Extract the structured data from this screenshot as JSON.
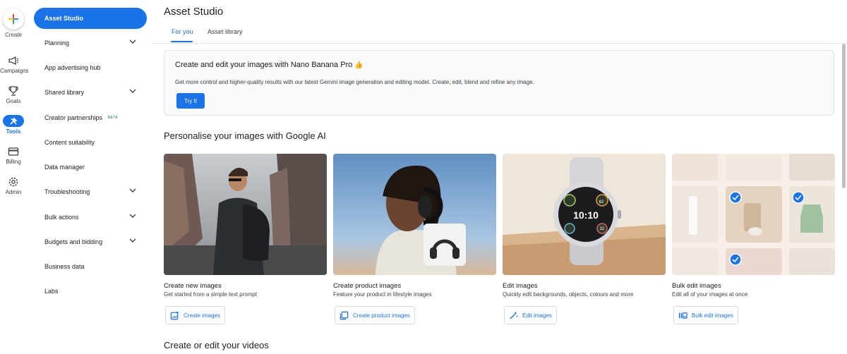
{
  "rail": {
    "create_label": "Create",
    "items": [
      {
        "label": "Campaigns",
        "icon": "megaphone-icon"
      },
      {
        "label": "Goals",
        "icon": "trophy-icon"
      },
      {
        "label": "Tools",
        "icon": "tools-icon"
      },
      {
        "label": "Billing",
        "icon": "credit-card-icon"
      },
      {
        "label": "Admin",
        "icon": "gear-icon"
      }
    ]
  },
  "sidebar": {
    "items": [
      {
        "label": "Asset Studio"
      },
      {
        "label": "Planning"
      },
      {
        "label": "App advertising hub"
      },
      {
        "label": "Shared library"
      },
      {
        "label": "Creator partnerships",
        "badge": "BETA"
      },
      {
        "label": "Content suitability"
      },
      {
        "label": "Data manager"
      },
      {
        "label": "Troubleshooting"
      },
      {
        "label": "Bulk actions"
      },
      {
        "label": "Budgets and bidding"
      },
      {
        "label": "Business data"
      },
      {
        "label": "Labs"
      }
    ]
  },
  "header": {
    "title": "Asset Studio",
    "tabs": [
      {
        "label": "For you"
      },
      {
        "label": "Asset library"
      }
    ]
  },
  "banner": {
    "title": "Create and edit your images with Nano Banana Pro",
    "emoji": "👍",
    "description": "Get more control and higher-quality results with our latest Gemini image generation and editing model. Create, edit, blend and refine any image.",
    "button_label": "Try It"
  },
  "section_images_title": "Personalise your images with Google AI",
  "cards": [
    {
      "title": "Create new images",
      "description": "Get started from a simple text prompt",
      "button_label": "Create images",
      "icon": "add-image-icon"
    },
    {
      "title": "Create product images",
      "description": "Feature your product in lifestyle images",
      "button_label": "Create product images",
      "icon": "product-image-icon"
    },
    {
      "title": "Edit images",
      "description": "Quickly edit backgrounds, objects, colours and more",
      "button_label": "Edit images",
      "icon": "magic-wand-icon"
    },
    {
      "title": "Bulk edit images",
      "description": "Edit all of your images at once",
      "button_label": "Bulk edit images",
      "icon": "bulk-edit-icon"
    }
  ],
  "watch_display": {
    "time": "10:10",
    "left_dial": "62",
    "right_dial": "32"
  },
  "section_videos_title": "Create or edit your videos",
  "colors": {
    "accent": "#1a73e8",
    "beta": "#188038"
  }
}
